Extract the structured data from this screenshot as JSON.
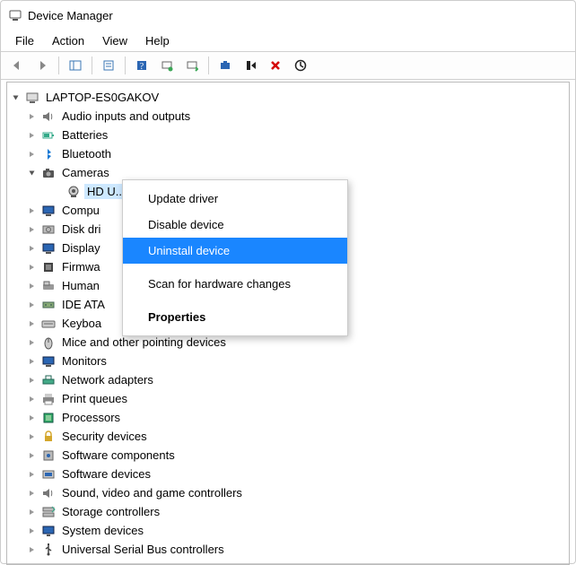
{
  "window": {
    "title": "Device Manager"
  },
  "menubar": [
    "File",
    "Action",
    "View",
    "Help"
  ],
  "tree": {
    "root": "LAPTOP-ES0GAKOV",
    "nodes": [
      {
        "label": "Audio inputs and outputs",
        "icon": "speaker"
      },
      {
        "label": "Batteries",
        "icon": "battery"
      },
      {
        "label": "Bluetooth",
        "icon": "bluetooth"
      },
      {
        "label": "Cameras",
        "icon": "camera",
        "expanded": true,
        "children": [
          {
            "label": "HD U...",
            "icon": "webcam",
            "selected": true
          }
        ]
      },
      {
        "label": "Compu",
        "icon": "monitor"
      },
      {
        "label": "Disk dri",
        "icon": "disk"
      },
      {
        "label": "Display",
        "icon": "monitor"
      },
      {
        "label": "Firmwa",
        "icon": "chip"
      },
      {
        "label": "Human",
        "icon": "hid"
      },
      {
        "label": "IDE ATA",
        "icon": "ide"
      },
      {
        "label": "Keyboa",
        "icon": "keyboard"
      },
      {
        "label": "Mice and other pointing devices",
        "icon": "mouse"
      },
      {
        "label": "Monitors",
        "icon": "monitor"
      },
      {
        "label": "Network adapters",
        "icon": "network"
      },
      {
        "label": "Print queues",
        "icon": "printer"
      },
      {
        "label": "Processors",
        "icon": "cpu"
      },
      {
        "label": "Security devices",
        "icon": "security"
      },
      {
        "label": "Software components",
        "icon": "swcomp"
      },
      {
        "label": "Software devices",
        "icon": "swdev"
      },
      {
        "label": "Sound, video and game controllers",
        "icon": "speaker"
      },
      {
        "label": "Storage controllers",
        "icon": "storage"
      },
      {
        "label": "System devices",
        "icon": "system"
      },
      {
        "label": "Universal Serial Bus controllers",
        "icon": "usb"
      }
    ]
  },
  "context_menu": {
    "items": [
      {
        "label": "Update driver"
      },
      {
        "label": "Disable device"
      },
      {
        "label": "Uninstall device",
        "selected": true
      },
      {
        "gap": true
      },
      {
        "label": "Scan for hardware changes"
      },
      {
        "gap": true
      },
      {
        "label": "Properties",
        "bold": true
      }
    ]
  }
}
